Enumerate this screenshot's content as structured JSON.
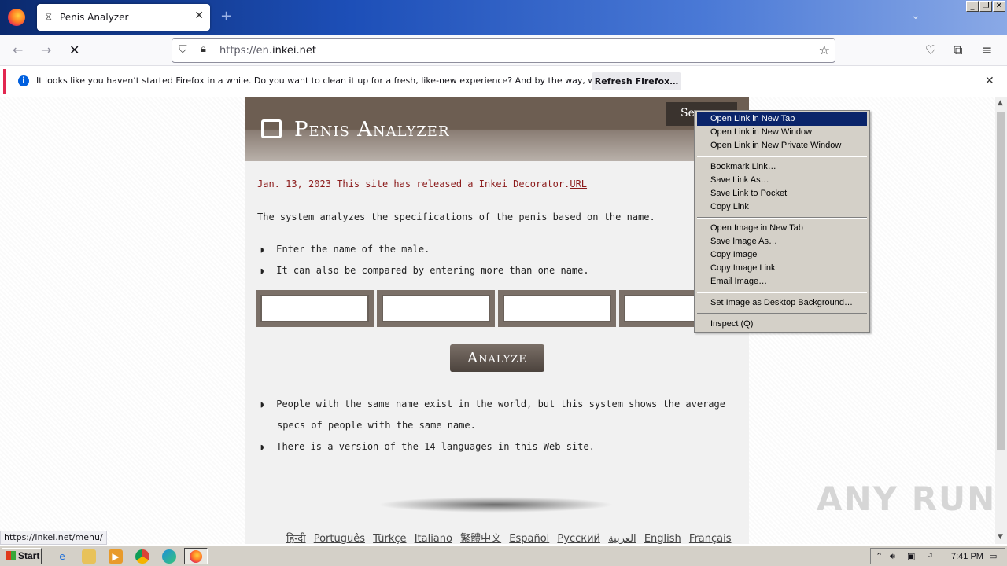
{
  "browser": {
    "tab_title": "Penis Analyzer",
    "url_prefix": "https://en.",
    "url_domain": "inkei.net",
    "notification_text": "It looks like you haven’t started Firefox in a while. Do you want to clean it up for a fresh, like-new experience? And by the way, welcome back!",
    "notification_button": "Refresh Firefox…",
    "status_url": "https://inkei.net/menu/"
  },
  "site": {
    "title": "Penis Analyzer",
    "search_label": "Se",
    "news": "Jan. 13, 2023 This site has released a Inkei Decorator.",
    "news_link": "URL",
    "description": "The system analyzes the specifications of the penis based on the name.",
    "bullets_top": [
      "Enter the name of the male.",
      "It can also be compared by entering more than one name."
    ],
    "analyze_button": "Analyze",
    "bullets_bottom": [
      "People with the same name exist in the world, but this system shows the average",
      "specs of people with the same name.",
      "There is a version of the 14 languages in this Web site."
    ],
    "languages": [
      "हिन्दी",
      "Português",
      "Türkçe",
      "Italiano",
      "繁體中文",
      "Español",
      "Русский",
      "العربية",
      "English",
      "Français"
    ]
  },
  "context_menu": {
    "items": [
      "Open Link in New Tab",
      "Open Link in New Window",
      "Open Link in New Private Window",
      "Bookmark Link…",
      "Save Link As…",
      "Save Link to Pocket",
      "Copy Link",
      "Open Image in New Tab",
      "Save Image As…",
      "Copy Image",
      "Copy Image Link",
      "Email Image…",
      "Set Image as Desktop Background…",
      "Inspect (Q)"
    ]
  },
  "taskbar": {
    "start_label": "Start",
    "clock": "7:41 PM"
  },
  "watermark": "ANY RUN"
}
